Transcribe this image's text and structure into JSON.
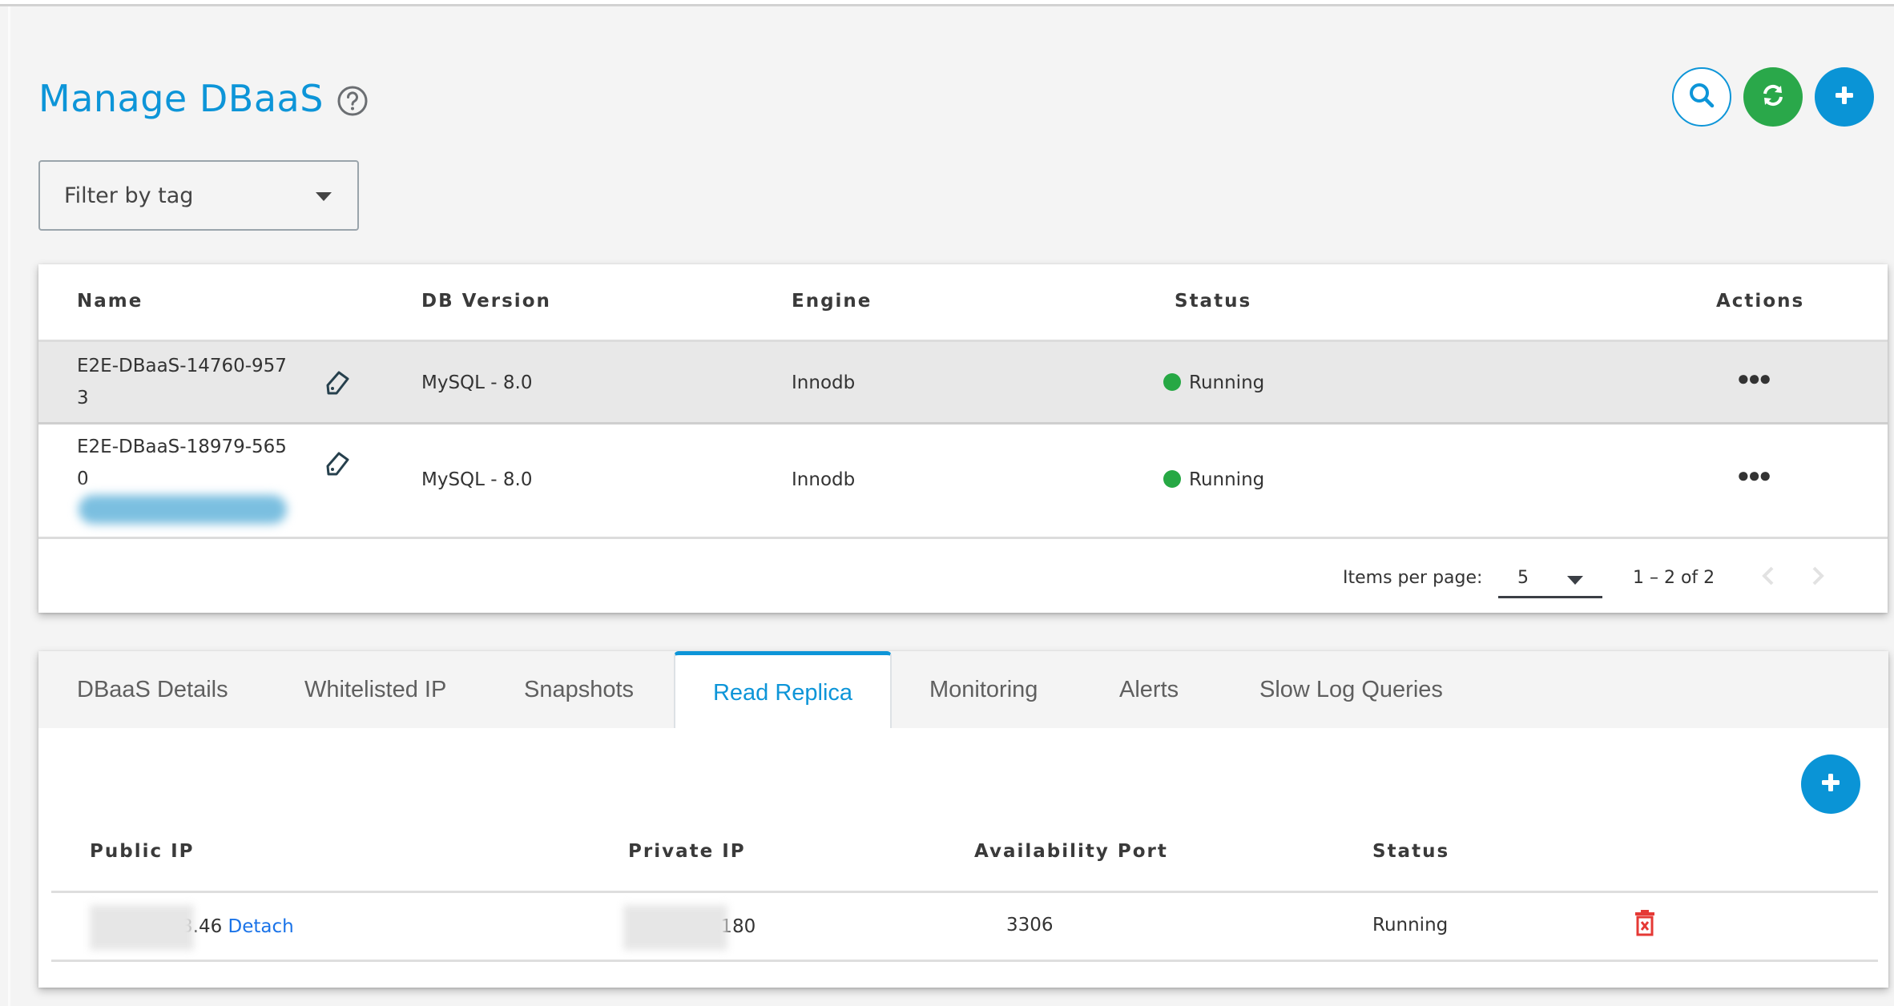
{
  "header": {
    "title": "Manage DBaaS",
    "help_icon": "question-circle-icon",
    "buttons": [
      {
        "name": "search",
        "icon": "search-icon"
      },
      {
        "name": "refresh",
        "icon": "refresh-icon"
      },
      {
        "name": "add",
        "icon": "plus-icon"
      }
    ]
  },
  "filter": {
    "placeholder": "Filter by tag",
    "icon": "caret-down-icon"
  },
  "colors": {
    "accent": "#0d95d8",
    "success": "#26a844",
    "danger": "#e53935",
    "link": "#1a73e8"
  },
  "table": {
    "columns": [
      "Name",
      "DB Version",
      "Engine",
      "Status",
      "Actions"
    ],
    "rows": [
      {
        "name_line1": "E2E-DBaaS-14760-957",
        "name_line2": "3",
        "db_version": "MySQL - 8.0",
        "engine": "Innodb",
        "status": "Running",
        "actions_icon": "more-horizontal-icon",
        "selected": true
      },
      {
        "name_line1": "E2E-DBaaS-18979-565",
        "name_line2": "0",
        "db_version": "MySQL - 8.0",
        "engine": "Innodb",
        "status": "Running",
        "actions_icon": "more-horizontal-icon",
        "selected": false
      }
    ],
    "paginator": {
      "items_per_page_label": "Items per page:",
      "items_per_page_value": "5",
      "range_label": "1 – 2 of 2"
    }
  },
  "tabs": [
    {
      "label": "DBaaS Details",
      "active": false
    },
    {
      "label": "Whitelisted IP",
      "active": false
    },
    {
      "label": "Snapshots",
      "active": false
    },
    {
      "label": "Read Replica",
      "active": true
    },
    {
      "label": "Monitoring",
      "active": false
    },
    {
      "label": "Alerts",
      "active": false
    },
    {
      "label": "Slow Log Queries",
      "active": false
    }
  ],
  "replica": {
    "columns": [
      "Public IP",
      "Private IP",
      "Availability Port",
      "Status"
    ],
    "rows": [
      {
        "public_ip_visible": "3.46",
        "detach_label": "Detach",
        "private_ip_visible": ".180",
        "port": "3306",
        "status": "Running",
        "delete_icon": "trash-icon"
      }
    ]
  }
}
